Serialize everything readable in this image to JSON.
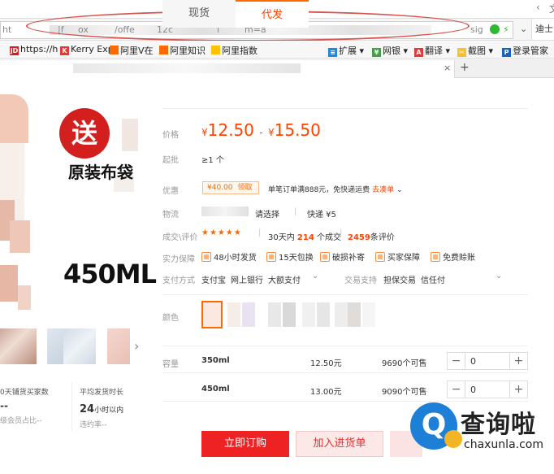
{
  "browser": {
    "window_controls": [
      "‹",
      "文"
    ],
    "url_text": "ht",
    "url_fragments": [
      "|f",
      "ox",
      "/offe",
      "12c",
      "l",
      "m=a"
    ],
    "address_icons": [
      "sig"
    ],
    "right_control": "迪士",
    "tab_add": "+"
  },
  "bookmarks": [
    {
      "label": "https://h",
      "icon": "jd-icon",
      "icon_text": "JD"
    },
    {
      "label": "Kerry Exp",
      "icon": "k-icon",
      "icon_text": "K"
    },
    {
      "label": "阿里V在",
      "icon": "ali-icon",
      "icon_text": ""
    },
    {
      "label": "阿里知识",
      "icon": "ali-icon",
      "icon_text": ""
    },
    {
      "label": "阿里指数",
      "icon": "ali-icon",
      "icon_text": ""
    },
    {
      "label": "扩展",
      "icon": "extension-icon",
      "icon_text": "≡"
    },
    {
      "label": "网银",
      "icon": "bank-icon",
      "icon_text": "¥"
    },
    {
      "label": "翻译",
      "icon": "translate-icon",
      "icon_text": "A"
    },
    {
      "label": "截图",
      "icon": "scissors-icon",
      "icon_text": "✂"
    },
    {
      "label": "登录管家",
      "icon": "key-icon",
      "icon_text": "P"
    }
  ],
  "product": {
    "badge": "送",
    "badge_text": "原装布袋",
    "capacity_text": "450ML"
  },
  "tabs": {
    "spot": "现货",
    "dropship": "代发"
  },
  "price": {
    "label": "价格",
    "currency": "¥",
    "low": "12.50",
    "high": "15.50",
    "separator": "-"
  },
  "moq": {
    "label": "起批",
    "value": "≥1 个"
  },
  "promo": {
    "label": "优惠",
    "coupon_value": "¥40.00",
    "coupon_action": "领取",
    "text": "单笔订单满888元，免快递运费",
    "link": "去凑单"
  },
  "shipping": {
    "label": "物流",
    "select": "请选择",
    "method": "快递 ¥5"
  },
  "reviews": {
    "label": "成交\\评价",
    "stars": "★★★★★",
    "days_prefix": "30天内",
    "deals": "214",
    "deals_suffix": "个成交",
    "review_count": "2459",
    "review_suffix": "条评价"
  },
  "guarantee": {
    "label": "实力保障",
    "items": [
      "48小时发货",
      "15天包换",
      "破损补寄",
      "买家保障",
      "免费赊账"
    ]
  },
  "payment": {
    "label": "支付方式",
    "methods": [
      "支付宝",
      "网上银行",
      "大额支付"
    ],
    "trade_label": "交易支持",
    "trade_items": [
      "担保交易",
      "信任付"
    ]
  },
  "color": {
    "label": "颜色"
  },
  "variants": {
    "label": "容量",
    "rows": [
      {
        "size": "350ml",
        "price": "12.50元",
        "stock": "9690个可售",
        "qty": "0"
      },
      {
        "size": "450ml",
        "price": "13.00元",
        "stock": "9090个可售",
        "qty": "0"
      }
    ],
    "minus": "−",
    "plus": "+"
  },
  "seller_stats": {
    "left_title": "0天铺货买家数",
    "left_value": "--",
    "left_note": "级会员占比--",
    "right_title": "平均发货时长",
    "right_value": "24",
    "right_unit": "小时以内",
    "right_note": "违约率--"
  },
  "actions": {
    "buy_now": "立即订购",
    "add_cart": "加入进货单"
  },
  "watermark": {
    "logo": "Q",
    "cn": "查询啦",
    "en": "chaxunla.com"
  },
  "colors": {
    "accent": "#ff4400",
    "buy": "#e22222",
    "annotation": "#d9534f",
    "watermark_blue": "#1e7fd6"
  }
}
